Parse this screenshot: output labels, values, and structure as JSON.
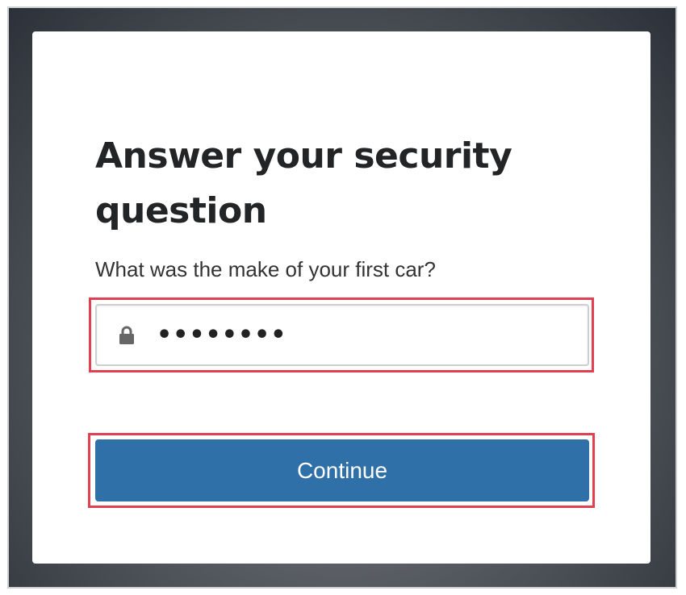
{
  "page": {
    "title": "Answer your security question",
    "question": "What was the make of your first car?"
  },
  "answer_field": {
    "value": "••••••••",
    "icon": "lock-icon"
  },
  "actions": {
    "continue_label": "Continue"
  },
  "colors": {
    "button": "#3070a8",
    "highlight": "#e04050",
    "title_text": "#222426"
  }
}
